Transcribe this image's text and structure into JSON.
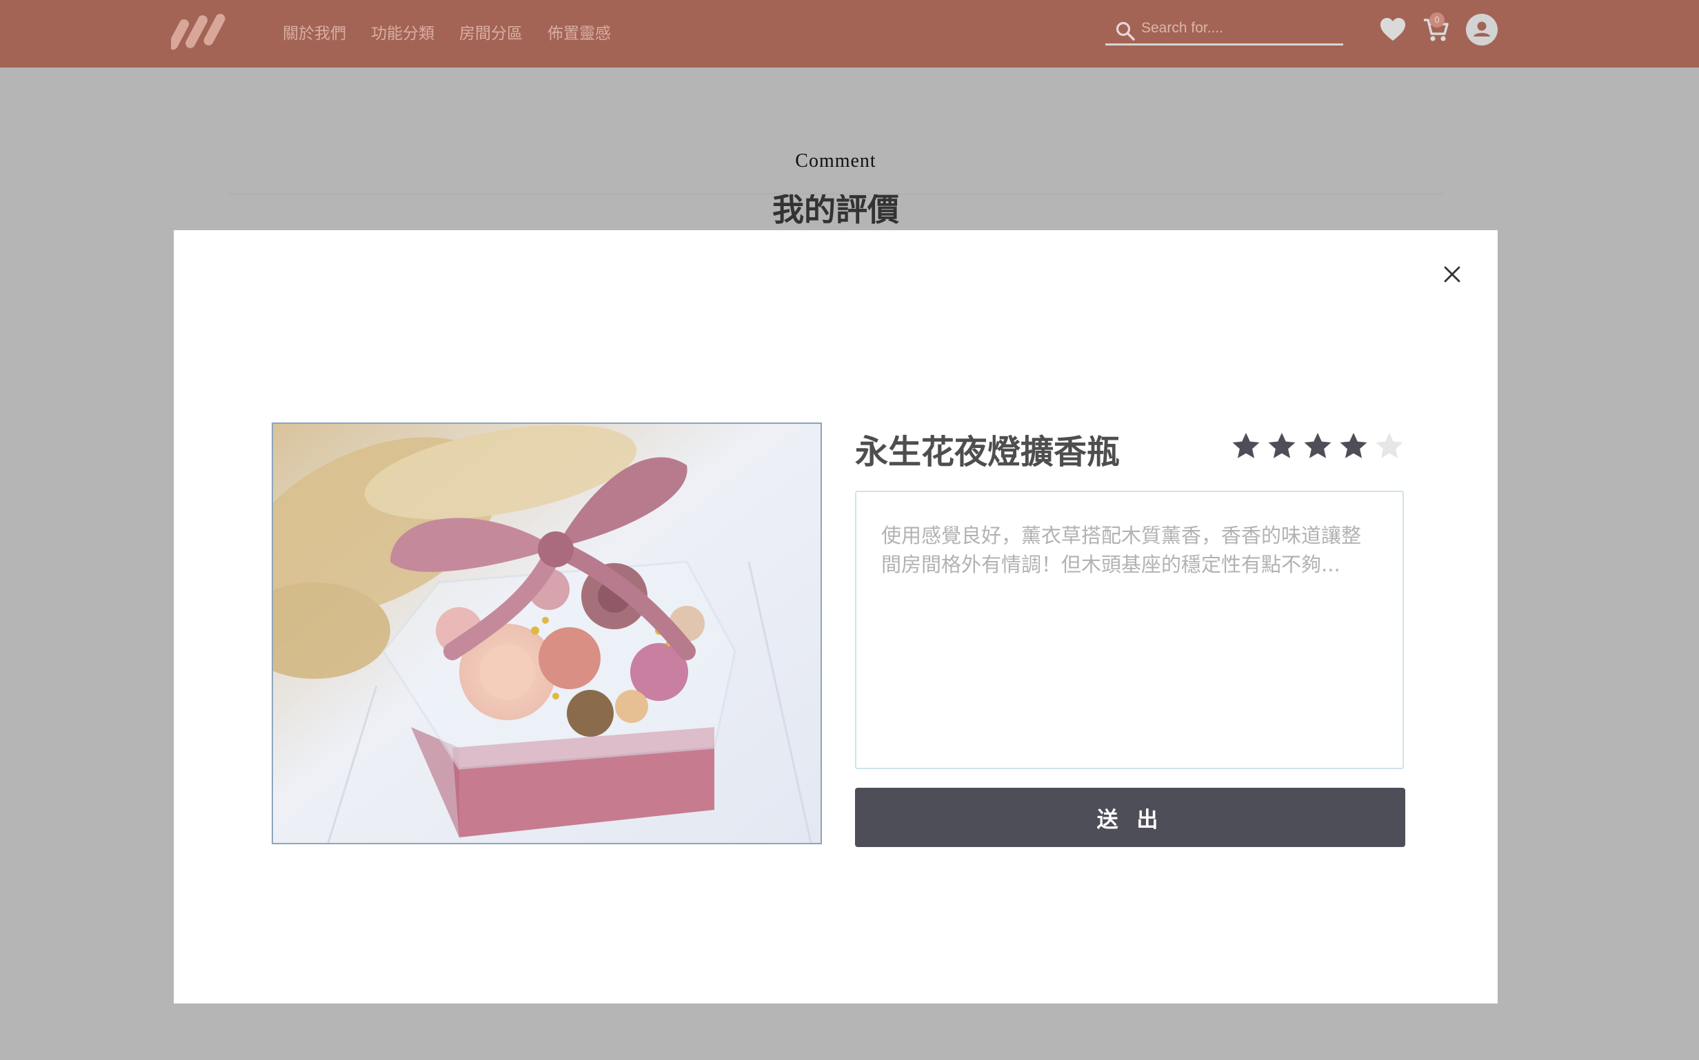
{
  "navbar": {
    "brand_logo": "brand-logo",
    "links": [
      "關於我們",
      "功能分類",
      "房間分區",
      "佈置靈感"
    ],
    "search": {
      "placeholder": "Search for...."
    },
    "cart_count": "0",
    "icons": [
      "heart-icon",
      "cart-icon",
      "user-icon"
    ]
  },
  "page": {
    "eyebrow": "Comment",
    "title": "我的評價"
  },
  "modal": {
    "product_name": "永生花夜燈擴香瓶",
    "rating": 4,
    "rating_max": 5,
    "review_placeholder": "使用感覺良好，薰衣草搭配木質薰香，香香的味道讓整間房間格外有情調！但木頭基座的穩定性有點不夠...",
    "submit_label": "送 出",
    "image_subject": "preserved-flower-box"
  },
  "colors": {
    "navbar": "#a36455",
    "backdrop": "#b5b5b5",
    "button": "#4e4e58",
    "star_on": "#4e4e58",
    "star_off": "#e6e6e6"
  }
}
